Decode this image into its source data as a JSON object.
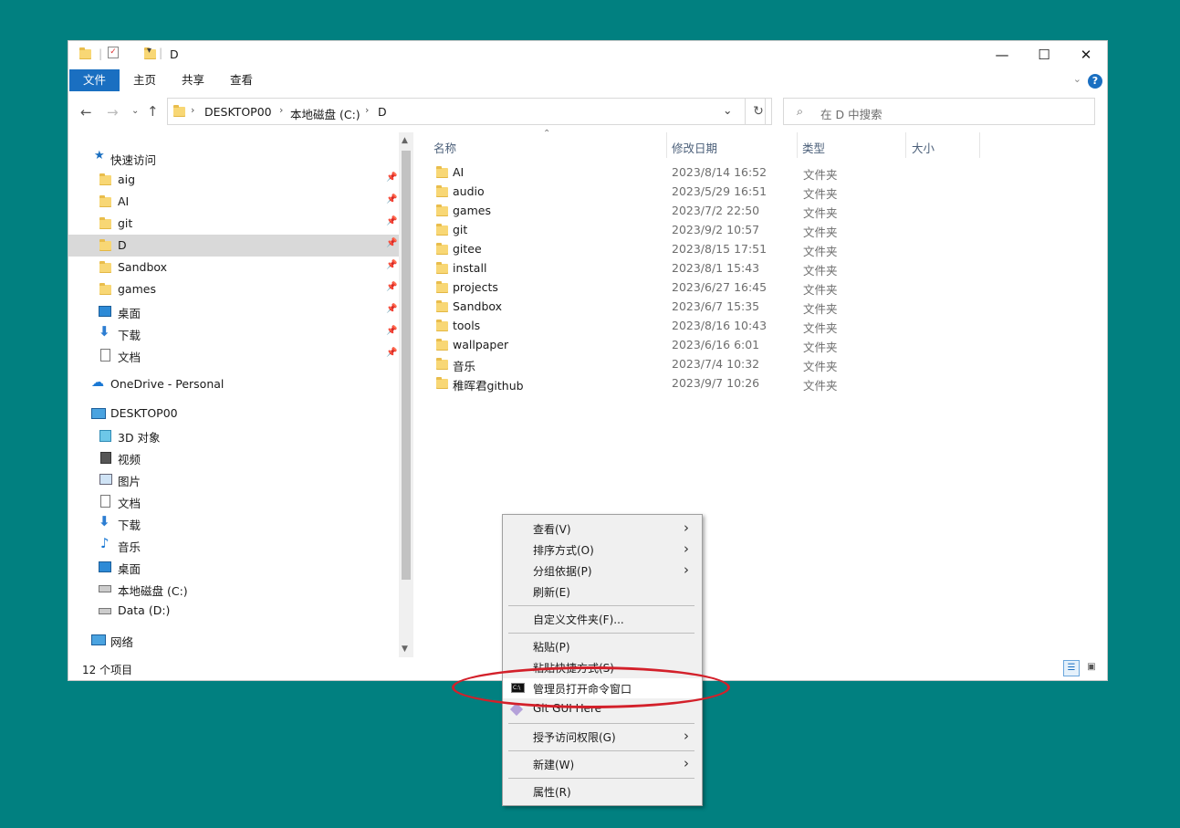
{
  "window": {
    "title": "D",
    "controls": {
      "minimize": "—",
      "maximize": "☐",
      "close": "✕"
    }
  },
  "ribbon": {
    "tabs": [
      "文件",
      "主页",
      "共享",
      "查看"
    ],
    "help": "?"
  },
  "address": {
    "crumbs": [
      "DESKTOP00",
      "本地磁盘 (C:)",
      "D"
    ],
    "search_placeholder": "在 D 中搜索"
  },
  "nav": {
    "quick_access": "快速访问",
    "pinned": [
      "aig",
      "AI",
      "git",
      "D",
      "Sandbox",
      "games",
      "桌面",
      "下载",
      "文档"
    ],
    "onedrive": "OneDrive - Personal",
    "pc": "DESKTOP00",
    "pc_items": [
      "3D 对象",
      "视频",
      "图片",
      "文档",
      "下载",
      "音乐",
      "桌面",
      "本地磁盘 (C:)",
      "Data (D:)"
    ],
    "network": "网络"
  },
  "list": {
    "columns": [
      "名称",
      "修改日期",
      "类型",
      "大小"
    ],
    "rows": [
      {
        "name": "AI",
        "date": "2023/8/14 16:52",
        "type": "文件夹"
      },
      {
        "name": "audio",
        "date": "2023/5/29 16:51",
        "type": "文件夹"
      },
      {
        "name": "games",
        "date": "2023/7/2 22:50",
        "type": "文件夹"
      },
      {
        "name": "git",
        "date": "2023/9/2 10:57",
        "type": "文件夹"
      },
      {
        "name": "gitee",
        "date": "2023/8/15 17:51",
        "type": "文件夹"
      },
      {
        "name": "install",
        "date": "2023/8/1 15:43",
        "type": "文件夹"
      },
      {
        "name": "projects",
        "date": "2023/6/27 16:45",
        "type": "文件夹"
      },
      {
        "name": "Sandbox",
        "date": "2023/6/7 15:35",
        "type": "文件夹"
      },
      {
        "name": "tools",
        "date": "2023/8/16 10:43",
        "type": "文件夹"
      },
      {
        "name": "wallpaper",
        "date": "2023/6/16 6:01",
        "type": "文件夹"
      },
      {
        "name": "音乐",
        "date": "2023/7/4 10:32",
        "type": "文件夹"
      },
      {
        "name": "稚晖君github",
        "date": "2023/9/7 10:26",
        "type": "文件夹"
      }
    ]
  },
  "status": "12 个项目",
  "context_menu": {
    "items": [
      {
        "label": "查看(V)",
        "submenu": true
      },
      {
        "label": "排序方式(O)",
        "submenu": true
      },
      {
        "label": "分组依据(P)",
        "submenu": true
      },
      {
        "label": "刷新(E)"
      },
      {
        "label": "自定义文件夹(F)..."
      },
      {
        "label": "粘贴(P)"
      },
      {
        "label": "粘贴快捷方式(S)"
      },
      {
        "label": "管理员打开命令窗口",
        "icon": "cmd-icon"
      },
      {
        "label": "Git GUI Here",
        "icon": "git-icon"
      },
      {
        "label": "授予访问权限(G)",
        "submenu": true
      },
      {
        "label": "新建(W)",
        "submenu": true
      },
      {
        "label": "属性(R)"
      }
    ]
  },
  "colors": {
    "desktop": "#018080",
    "accent": "#1a6fc1",
    "highlight_ring": "#d3202a"
  }
}
